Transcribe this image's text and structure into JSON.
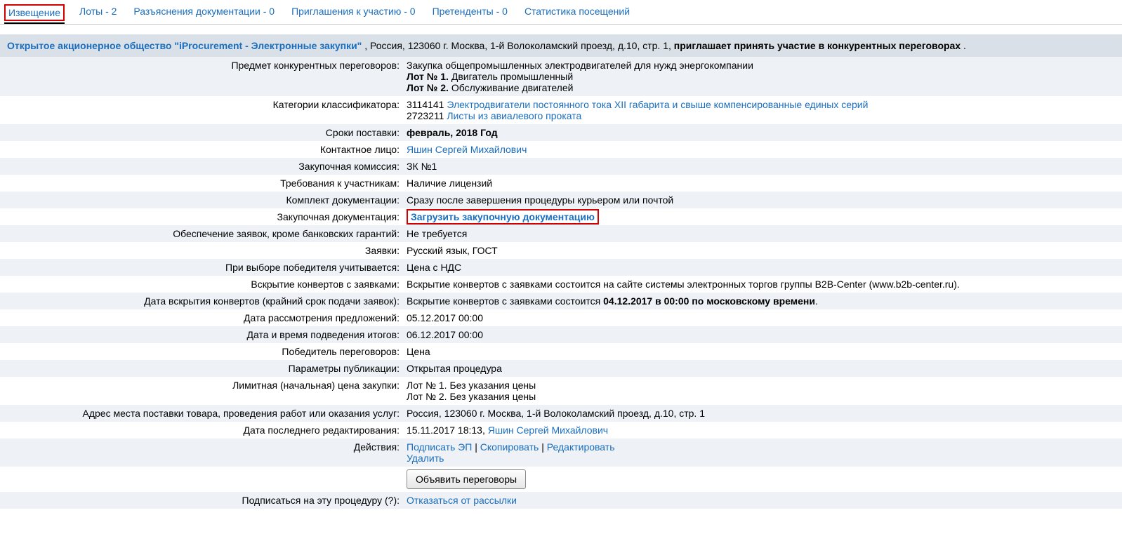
{
  "tabs": [
    {
      "label": "Извещение",
      "active": true
    },
    {
      "label": "Лоты - 2",
      "active": false
    },
    {
      "label": "Разъяснения документации - 0",
      "active": false
    },
    {
      "label": "Приглашения к участию - 0",
      "active": false
    },
    {
      "label": "Претенденты - 0",
      "active": false
    },
    {
      "label": "Статистика посещений",
      "active": false
    }
  ],
  "header": {
    "org_name": "Открытое акционерное общество \"iProcurement - Электронные закупки\"",
    "address": " , Россия, 123060 г. Москва, 1-й Волоколамский проезд, д.10, стр. 1, ",
    "invite": "приглашает принять участие в конкурентных переговорах",
    "tail": "."
  },
  "rows": {
    "subject": {
      "label": "Предмет конкурентных переговоров:",
      "text": "Закупка общепромышленных электродвигателей для нужд энергокомпании",
      "lot1_label": "Лот № 1.",
      "lot1_text": " Двигатель промышленный",
      "lot2_label": "Лот № 2.",
      "lot2_text": " Обслуживание двигателей"
    },
    "categories": {
      "label": "Категории классификатора:",
      "code1": "3114141 ",
      "link1": "Электродвигатели постоянного тока XII габарита и свыше компенсированные единых серий",
      "code2": "2723211 ",
      "link2": "Листы из авиалевого проката"
    },
    "delivery": {
      "label": "Сроки поставки:",
      "value": "февраль, 2018 Год"
    },
    "contact": {
      "label": "Контактное лицо:",
      "link": "Яшин Сергей Михайлович"
    },
    "commission": {
      "label": "Закупочная комиссия:",
      "value": "ЗК №1"
    },
    "requirements": {
      "label": "Требования к участникам:",
      "value": "Наличие лицензий"
    },
    "docset": {
      "label": "Комплект документации:",
      "value": "Сразу после завершения процедуры курьером или почтой"
    },
    "procdocs": {
      "label": "Закупочная документация:",
      "link": "Загрузить закупочную документацию"
    },
    "security": {
      "label": "Обеспечение заявок, кроме банковских гарантий:",
      "value": "Не требуется"
    },
    "applications": {
      "label": "Заявки:",
      "value": "Русский язык, ГОСТ"
    },
    "winner_crit": {
      "label": "При выборе победителя учитывается:",
      "value": "Цена с НДС"
    },
    "opening": {
      "label": "Вскрытие конвертов с заявками:",
      "value": "Вскрытие конвертов с заявками состоится на сайте системы электронных торгов группы B2B-Center (www.b2b-center.ru)."
    },
    "opening_date": {
      "label": "Дата вскрытия конвертов (крайний срок подачи заявок):",
      "prefix": "Вскрытие конвертов с заявками состоится ",
      "bold": "04.12.2017 в 00:00 по московскому времени",
      "suffix": "."
    },
    "review_date": {
      "label": "Дата рассмотрения предложений:",
      "value": "05.12.2017 00:00"
    },
    "result_date": {
      "label": "Дата и время подведения итогов:",
      "value": "06.12.2017 00:00"
    },
    "winner": {
      "label": "Победитель переговоров:",
      "value": "Цена"
    },
    "pub_params": {
      "label": "Параметры публикации:",
      "value": "Открытая процедура"
    },
    "limit_price": {
      "label": "Лимитная (начальная) цена закупки:",
      "line1": "Лот № 1. Без указания цены",
      "line2": "Лот № 2. Без указания цены"
    },
    "delivery_addr": {
      "label": "Адрес места поставки товара, проведения работ или оказания услуг:",
      "value": "Россия, 123060 г. Москва, 1-й Волоколамский проезд, д.10, стр. 1"
    },
    "last_edit": {
      "label": "Дата последнего редактирования:",
      "text": "15.11.2017 18:13, ",
      "link": "Яшин Сергей Михайлович"
    },
    "actions": {
      "label": "Действия:",
      "sign": "Подписать ЭП",
      "sep1": " | ",
      "copy": "Скопировать",
      "sep2": " | ",
      "edit": "Редактировать",
      "del": "Удалить"
    },
    "announce": {
      "label": "",
      "button": "Объявить переговоры"
    },
    "subscribe": {
      "label": "Подписаться на эту процедуру (?):",
      "link": "Отказаться от рассылки"
    }
  }
}
